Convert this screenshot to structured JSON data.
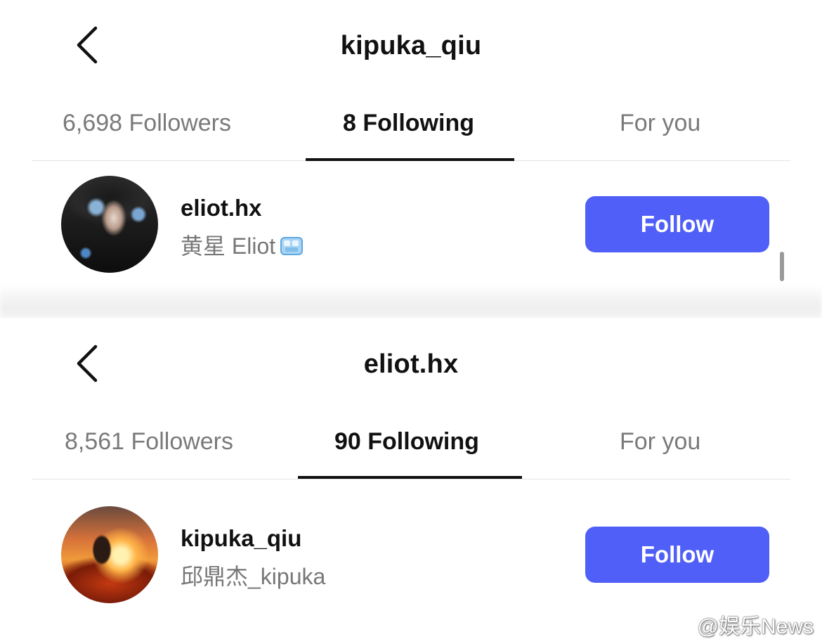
{
  "screens": [
    {
      "title": "kipuka_qiu",
      "tabs": {
        "followers": "6,698 Followers",
        "following": "8 Following",
        "for_you": "For you"
      },
      "active_tab": "following",
      "user": {
        "username": "eliot.hx",
        "full_name": "黄星 Eliot",
        "emoji": "ice-cube-emoji",
        "follow_label": "Follow"
      }
    },
    {
      "title": "eliot.hx",
      "tabs": {
        "followers": "8,561 Followers",
        "following": "90 Following",
        "for_you": "For you"
      },
      "active_tab": "following",
      "user": {
        "username": "kipuka_qiu",
        "full_name": "邱鼎杰_kipuka",
        "follow_label": "Follow"
      }
    }
  ],
  "watermark": "@娱乐News",
  "colors": {
    "follow_button": "#4f5ff7",
    "muted_text": "#7a7a7a",
    "active_underline": "#111111"
  }
}
